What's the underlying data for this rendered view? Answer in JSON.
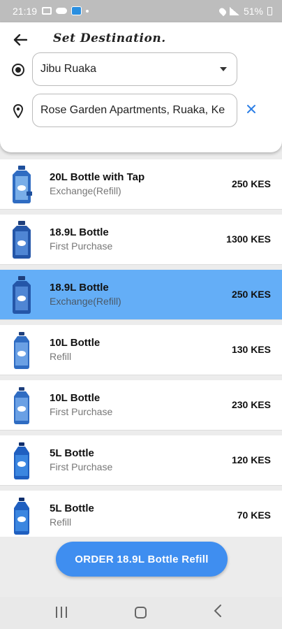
{
  "status_bar": {
    "time": "21:19",
    "battery": "51%"
  },
  "header": {
    "title": "Set Destination.",
    "origin_value": "Jibu Ruaka",
    "destination_value": "Rose Garden Apartments, Ruaka, Ke"
  },
  "products": [
    {
      "name": "20L Bottle with Tap",
      "type": "Exchange(Refill)",
      "price": "250 KES",
      "selected": false
    },
    {
      "name": "18.9L Bottle",
      "type": "First Purchase",
      "price": "1300 KES",
      "selected": false
    },
    {
      "name": "18.9L Bottle",
      "type": "Exchange(Refill)",
      "price": "250 KES",
      "selected": true
    },
    {
      "name": "10L Bottle",
      "type": "Refill",
      "price": "130 KES",
      "selected": false
    },
    {
      "name": "10L Bottle",
      "type": "First Purchase",
      "price": "230 KES",
      "selected": false
    },
    {
      "name": "5L Bottle",
      "type": "First Purchase",
      "price": "120 KES",
      "selected": false
    },
    {
      "name": "5L Bottle",
      "type": "Refill",
      "price": "70 KES",
      "selected": false
    }
  ],
  "order_button": {
    "label": "ORDER 18.9L Bottle Refill"
  },
  "icons": {
    "back": "arrow-left-icon",
    "origin": "radio-target-icon",
    "destination": "map-pin-icon",
    "clear": "close-icon",
    "dropdown": "caret-down-icon"
  },
  "colors": {
    "accent": "#3f8ef0",
    "selected_row": "#64aef7",
    "clear_icon": "#2d7fe6"
  }
}
